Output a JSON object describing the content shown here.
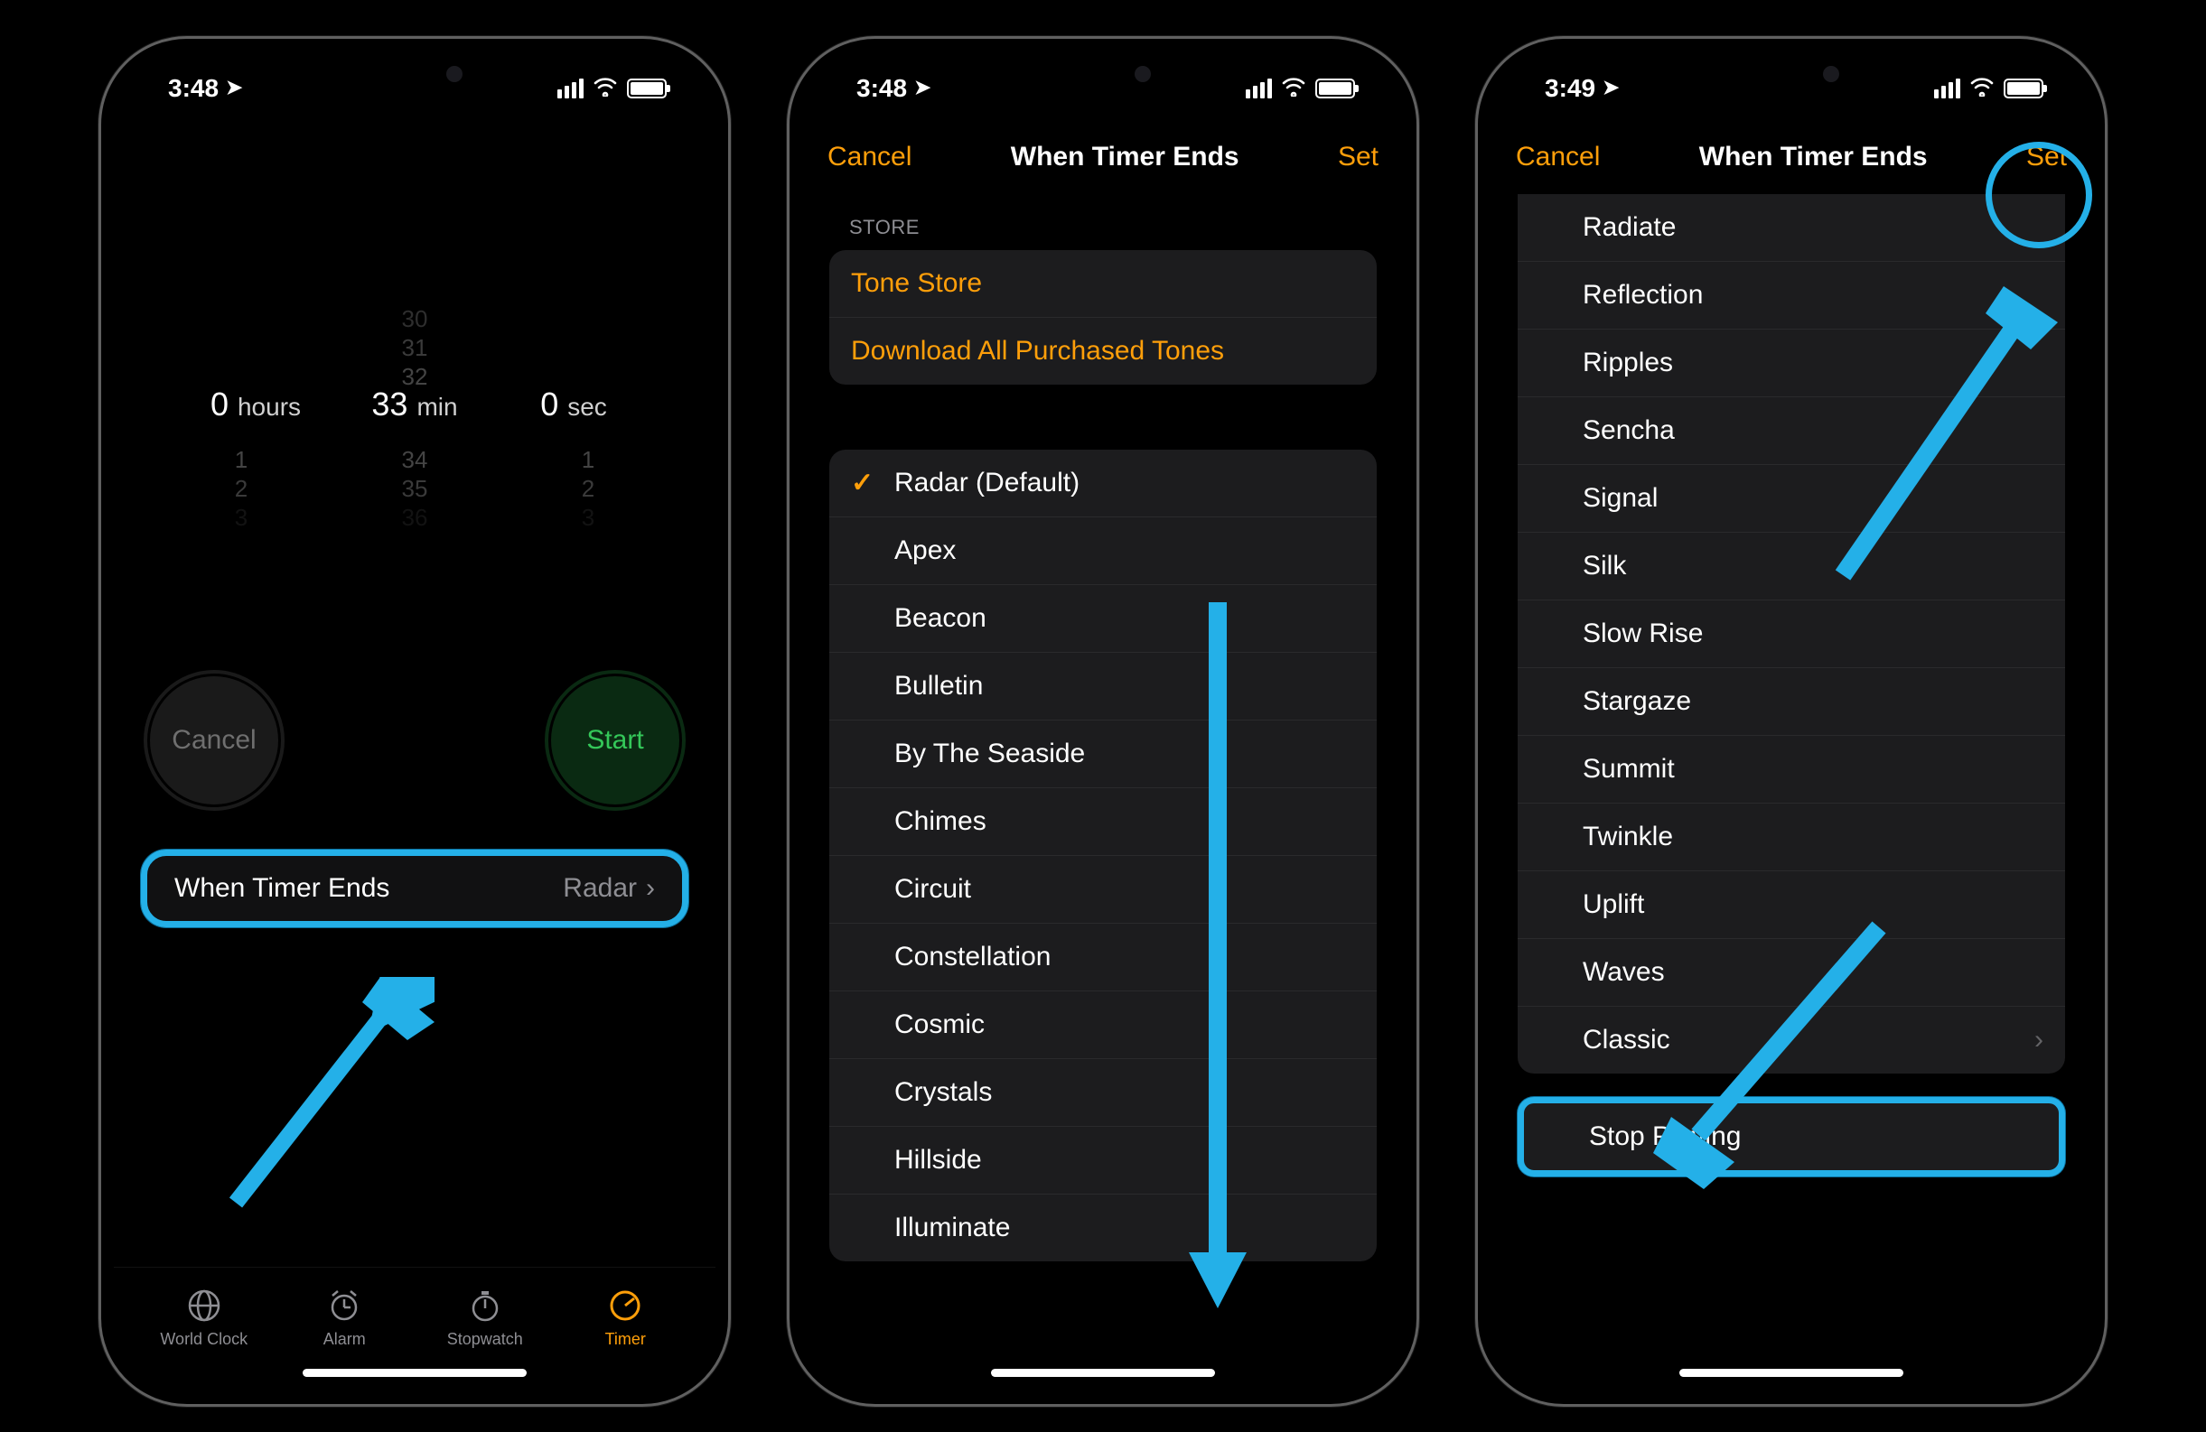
{
  "colors": {
    "accent": "#ff9f0a",
    "highlight": "#24b0e8",
    "start": "#34c759"
  },
  "phone1": {
    "time": "3:48",
    "picker": {
      "hours": "0",
      "minutes": "33",
      "seconds": "0",
      "hours_label": "hours",
      "min_label": "min",
      "sec_label": "sec",
      "above": {
        "r1": "30",
        "r2": "31",
        "r3": "32"
      },
      "below_min": {
        "r1": "34",
        "r2": "35",
        "r3": "36"
      },
      "below_side": {
        "r1": "1",
        "r2": "2",
        "r3": "3"
      }
    },
    "cancel": "Cancel",
    "start": "Start",
    "when_label": "When Timer Ends",
    "when_value": "Radar",
    "tabs": {
      "world": "World Clock",
      "alarm": "Alarm",
      "stopwatch": "Stopwatch",
      "timer": "Timer"
    }
  },
  "phone2": {
    "time": "3:48",
    "nav": {
      "cancel": "Cancel",
      "title": "When Timer Ends",
      "set": "Set"
    },
    "store_header": "Store",
    "store_links": {
      "tone_store": "Tone Store",
      "download": "Download All Purchased Tones"
    },
    "ringtones": [
      "Radar (Default)",
      "Apex",
      "Beacon",
      "Bulletin",
      "By The Seaside",
      "Chimes",
      "Circuit",
      "Constellation",
      "Cosmic",
      "Crystals",
      "Hillside",
      "Illuminate"
    ],
    "selected_index": 0
  },
  "phone3": {
    "time": "3:49",
    "nav": {
      "cancel": "Cancel",
      "title": "When Timer Ends",
      "set": "Set"
    },
    "ringtones": [
      "Radiate",
      "Reflection",
      "Ripples",
      "Sencha",
      "Signal",
      "Silk",
      "Slow Rise",
      "Stargaze",
      "Summit",
      "Twinkle",
      "Uplift",
      "Waves",
      "Classic"
    ],
    "classic_has_chevron": true,
    "stop_playing": "Stop Playing"
  }
}
